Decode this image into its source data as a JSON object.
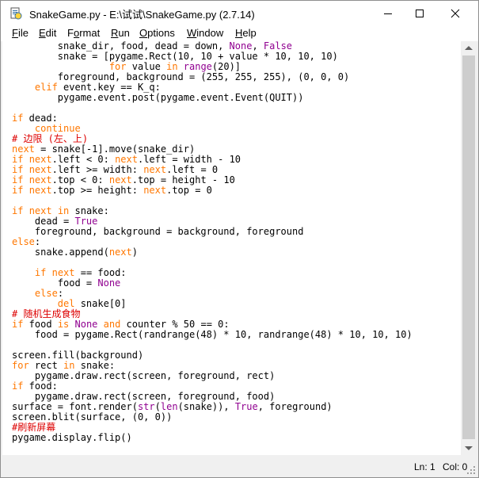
{
  "window": {
    "title": "SnakeGame.py - E:\\试试\\SnakeGame.py (2.7.14)",
    "icon": "python-idle-icon"
  },
  "menu": [
    {
      "label": "File",
      "accel": "F"
    },
    {
      "label": "Edit",
      "accel": "E"
    },
    {
      "label": "Format",
      "accel": "o"
    },
    {
      "label": "Run",
      "accel": "R"
    },
    {
      "label": "Options",
      "accel": "O"
    },
    {
      "label": "Window",
      "accel": "W"
    },
    {
      "label": "Help",
      "accel": "H"
    }
  ],
  "code_lines": [
    [
      [
        "",
        "        snake_dir, food, dead = down, "
      ],
      [
        "bi",
        "None"
      ],
      [
        "",
        ", "
      ],
      [
        "bi",
        "False"
      ]
    ],
    [
      [
        "",
        "        snake = [pygame.Rect(10, 10 + value * 10, 10, 10)"
      ]
    ],
    [
      [
        "",
        "                 "
      ],
      [
        "kw",
        "for"
      ],
      [
        "",
        " value "
      ],
      [
        "kw",
        "in"
      ],
      [
        "",
        " "
      ],
      [
        "bi",
        "range"
      ],
      [
        "",
        "(20)]"
      ]
    ],
    [
      [
        "",
        "        foreground, background = (255, 255, 255), (0, 0, 0)"
      ]
    ],
    [
      [
        "",
        "    "
      ],
      [
        "kw",
        "elif"
      ],
      [
        "",
        " event.key == K_q:"
      ]
    ],
    [
      [
        "",
        "        pygame.event.post(pygame.event.Event(QUIT))"
      ]
    ],
    [
      [
        "",
        ""
      ]
    ],
    [
      [
        "kw",
        "if"
      ],
      [
        "",
        " dead:"
      ]
    ],
    [
      [
        "",
        "    "
      ],
      [
        "kw",
        "continue"
      ]
    ],
    [
      [
        "cm",
        "# 边限 (左、上)"
      ]
    ],
    [
      [
        "kw",
        "next"
      ],
      [
        "",
        " = snake[-1].move(snake_dir)"
      ]
    ],
    [
      [
        "kw",
        "if"
      ],
      [
        "",
        " "
      ],
      [
        "kw",
        "next"
      ],
      [
        "",
        ".left < 0: "
      ],
      [
        "kw",
        "next"
      ],
      [
        "",
        ".left = width - 10"
      ]
    ],
    [
      [
        "kw",
        "if"
      ],
      [
        "",
        " "
      ],
      [
        "kw",
        "next"
      ],
      [
        "",
        ".left >= width: "
      ],
      [
        "kw",
        "next"
      ],
      [
        "",
        ".left = 0"
      ]
    ],
    [
      [
        "kw",
        "if"
      ],
      [
        "",
        " "
      ],
      [
        "kw",
        "next"
      ],
      [
        "",
        ".top < 0: "
      ],
      [
        "kw",
        "next"
      ],
      [
        "",
        ".top = height - 10"
      ]
    ],
    [
      [
        "kw",
        "if"
      ],
      [
        "",
        " "
      ],
      [
        "kw",
        "next"
      ],
      [
        "",
        ".top >= height: "
      ],
      [
        "kw",
        "next"
      ],
      [
        "",
        ".top = 0"
      ]
    ],
    [
      [
        "",
        ""
      ]
    ],
    [
      [
        "kw",
        "if"
      ],
      [
        "",
        " "
      ],
      [
        "kw",
        "next"
      ],
      [
        "",
        " "
      ],
      [
        "kw",
        "in"
      ],
      [
        "",
        " snake:"
      ]
    ],
    [
      [
        "",
        "    dead = "
      ],
      [
        "bi",
        "True"
      ]
    ],
    [
      [
        "",
        "    foreground, background = background, foreground"
      ]
    ],
    [
      [
        "kw",
        "else"
      ],
      [
        "",
        ":"
      ]
    ],
    [
      [
        "",
        "    snake.append("
      ],
      [
        "kw",
        "next"
      ],
      [
        "",
        ")"
      ]
    ],
    [
      [
        "",
        ""
      ]
    ],
    [
      [
        "",
        "    "
      ],
      [
        "kw",
        "if"
      ],
      [
        "",
        " "
      ],
      [
        "kw",
        "next"
      ],
      [
        "",
        " == food:"
      ]
    ],
    [
      [
        "",
        "        food = "
      ],
      [
        "bi",
        "None"
      ]
    ],
    [
      [
        "",
        "    "
      ],
      [
        "kw",
        "else"
      ],
      [
        "",
        ":"
      ]
    ],
    [
      [
        "",
        "        "
      ],
      [
        "kw",
        "del"
      ],
      [
        "",
        " snake[0]"
      ]
    ],
    [
      [
        "cm",
        "# 随机生成食物"
      ]
    ],
    [
      [
        "kw",
        "if"
      ],
      [
        "",
        " food "
      ],
      [
        "kw",
        "is"
      ],
      [
        "",
        " "
      ],
      [
        "bi",
        "None"
      ],
      [
        "",
        " "
      ],
      [
        "kw",
        "and"
      ],
      [
        "",
        " counter % 50 == 0:"
      ]
    ],
    [
      [
        "",
        "    food = pygame.Rect(randrange(48) * 10, randrange(48) * 10, 10, 10)"
      ]
    ],
    [
      [
        "",
        ""
      ]
    ],
    [
      [
        "",
        "screen.fill(background)"
      ]
    ],
    [
      [
        "kw",
        "for"
      ],
      [
        "",
        " rect "
      ],
      [
        "kw",
        "in"
      ],
      [
        "",
        " snake:"
      ]
    ],
    [
      [
        "",
        "    pygame.draw.rect(screen, foreground, rect)"
      ]
    ],
    [
      [
        "kw",
        "if"
      ],
      [
        "",
        " food:"
      ]
    ],
    [
      [
        "",
        "    pygame.draw.rect(screen, foreground, food)"
      ]
    ],
    [
      [
        "",
        "surface = font.render("
      ],
      [
        "bi",
        "str"
      ],
      [
        "",
        "("
      ],
      [
        "bi",
        "len"
      ],
      [
        "",
        "(snake)), "
      ],
      [
        "bi",
        "True"
      ],
      [
        "",
        ", foreground)"
      ]
    ],
    [
      [
        "",
        "screen.blit(surface, (0, 0))"
      ]
    ],
    [
      [
        "cm",
        "#刷新屏幕"
      ]
    ],
    [
      [
        "",
        "pygame.display.flip()"
      ]
    ]
  ],
  "status": {
    "line": "Ln: 1",
    "col": "Col: 0"
  }
}
